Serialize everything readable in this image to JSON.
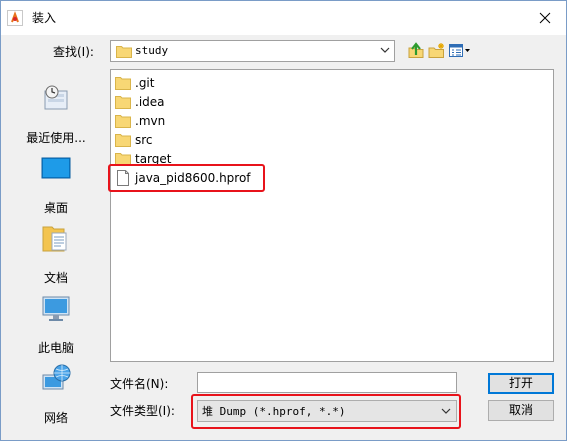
{
  "dialog": {
    "title": "装入",
    "close_glyph": "✕"
  },
  "toolbar": {
    "look_in_label": "查找(I):",
    "look_in_value": "study",
    "up_icon": "up-one-level-icon",
    "new_folder_icon": "new-folder-icon",
    "view_menu_icon": "view-menu-icon"
  },
  "places": [
    {
      "label": "最近使用...",
      "icon": "recent-items-icon"
    },
    {
      "label": "桌面",
      "icon": "desktop-icon"
    },
    {
      "label": "文档",
      "icon": "documents-icon"
    },
    {
      "label": "此电脑",
      "icon": "this-pc-icon"
    },
    {
      "label": "网络",
      "icon": "network-icon"
    }
  ],
  "files": [
    {
      "name": ".git",
      "type": "folder"
    },
    {
      "name": ".idea",
      "type": "folder"
    },
    {
      "name": ".mvn",
      "type": "folder"
    },
    {
      "name": "src",
      "type": "folder"
    },
    {
      "name": "target",
      "type": "folder"
    },
    {
      "name": "java_pid8600.hprof",
      "type": "file"
    }
  ],
  "form": {
    "file_name_label": "文件名(N):",
    "file_name_value": "",
    "file_type_label": "文件类型(I):",
    "file_type_value": "堆 Dump (*.hprof, *.*)"
  },
  "buttons": {
    "open": "打开",
    "cancel": "取消"
  },
  "colors": {
    "highlight_box": "#e8131b",
    "folder": "#f8d775",
    "default_button_border": "#0078d7"
  }
}
